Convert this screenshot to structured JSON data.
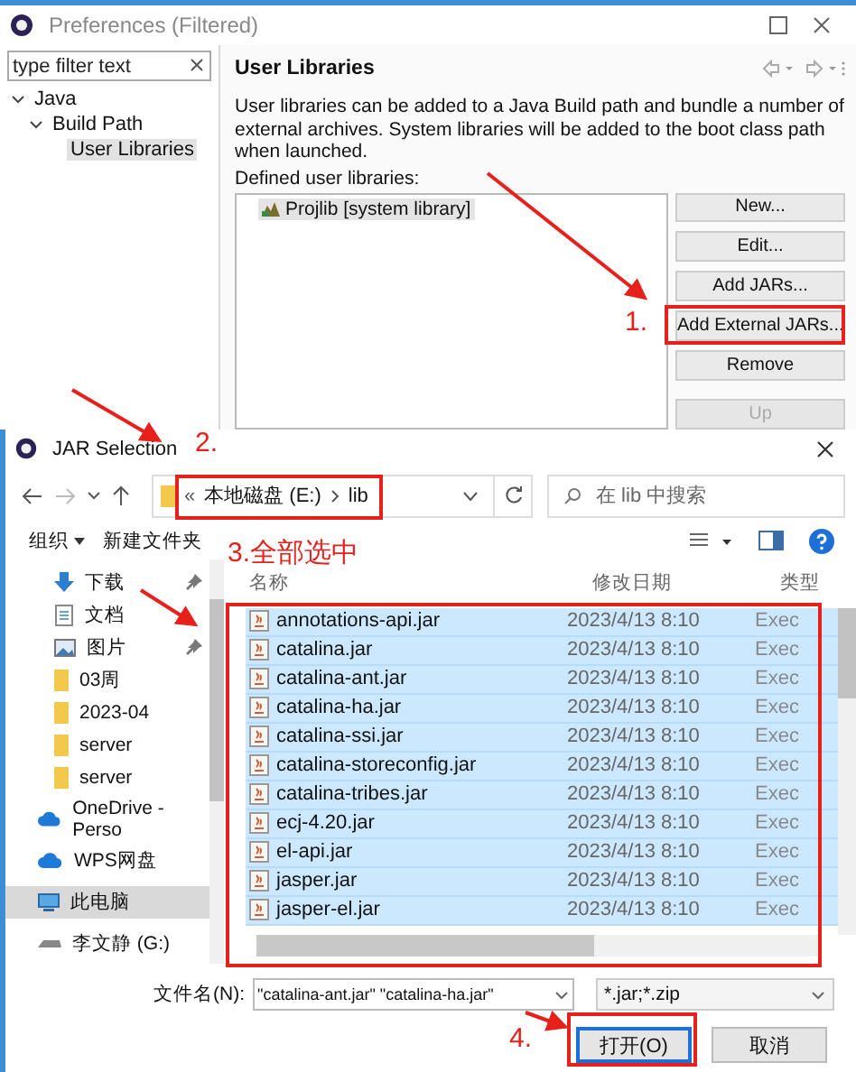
{
  "preferences": {
    "title": "Preferences (Filtered)",
    "filter": {
      "placeholder": "type filter text"
    },
    "tree": [
      {
        "label": "Java",
        "expanded": true,
        "selected": false,
        "children": [
          {
            "label": "Build Path",
            "expanded": true,
            "selected": false,
            "children": [
              {
                "label": "User Libraries",
                "selected": true
              }
            ]
          }
        ]
      }
    ],
    "page_title": "User Libraries",
    "description": "User libraries can be added to a Java Build path and bundle a number of external archives. System libraries will be added to the boot class path when launched.",
    "list_label": "Defined user libraries:",
    "libraries": [
      {
        "label": "Projlib [system library]",
        "selected": true
      }
    ],
    "buttons": [
      {
        "label": "New...",
        "disabled": false
      },
      {
        "label": "Edit...",
        "disabled": false
      },
      {
        "label": "Add JARs...",
        "disabled": false
      },
      {
        "label": "Add External JARs...",
        "disabled": false
      },
      {
        "label": "Remove",
        "disabled": false
      },
      {
        "label": "Up",
        "disabled": true
      }
    ]
  },
  "dialog": {
    "title": "JAR Selection",
    "path": [
      "本地磁盘 (E:)",
      "lib"
    ],
    "path_prefix": "«",
    "search": {
      "placeholder": "在 lib 中搜索"
    },
    "toolbar": {
      "organize": "组织",
      "new_folder": "新建文件夹"
    },
    "nav": [
      {
        "label": "下载",
        "kind": "download",
        "pinned": true,
        "selected": false
      },
      {
        "label": "文档",
        "kind": "document",
        "pinned": false,
        "selected": false
      },
      {
        "label": "图片",
        "kind": "pictures",
        "pinned": true,
        "selected": false
      },
      {
        "label": "03周",
        "kind": "folder",
        "pinned": false,
        "selected": false
      },
      {
        "label": "2023-04",
        "kind": "folder",
        "pinned": false,
        "selected": false
      },
      {
        "label": "server",
        "kind": "folder",
        "pinned": false,
        "selected": false
      },
      {
        "label": "server",
        "kind": "folder",
        "pinned": false,
        "selected": false
      },
      {
        "label": "OneDrive - Perso",
        "kind": "cloud",
        "pinned": false,
        "selected": false
      },
      {
        "label": "WPS网盘",
        "kind": "cloud",
        "pinned": false,
        "selected": false
      },
      {
        "label": "此电脑",
        "kind": "computer",
        "pinned": false,
        "selected": true
      },
      {
        "label": "李文静 (G:)",
        "kind": "drive",
        "pinned": false,
        "selected": false
      }
    ],
    "columns": [
      "名称",
      "修改日期",
      "类型"
    ],
    "files": [
      {
        "name": "annotations-api.jar",
        "date": "2023/4/13 8:10",
        "type": "Exec",
        "selected": true
      },
      {
        "name": "catalina.jar",
        "date": "2023/4/13 8:10",
        "type": "Exec",
        "selected": true
      },
      {
        "name": "catalina-ant.jar",
        "date": "2023/4/13 8:10",
        "type": "Exec",
        "selected": true
      },
      {
        "name": "catalina-ha.jar",
        "date": "2023/4/13 8:10",
        "type": "Exec",
        "selected": true
      },
      {
        "name": "catalina-ssi.jar",
        "date": "2023/4/13 8:10",
        "type": "Exec",
        "selected": true
      },
      {
        "name": "catalina-storeconfig.jar",
        "date": "2023/4/13 8:10",
        "type": "Exec",
        "selected": true
      },
      {
        "name": "catalina-tribes.jar",
        "date": "2023/4/13 8:10",
        "type": "Exec",
        "selected": true
      },
      {
        "name": "ecj-4.20.jar",
        "date": "2023/4/13 8:10",
        "type": "Exec",
        "selected": true
      },
      {
        "name": "el-api.jar",
        "date": "2023/4/13 8:10",
        "type": "Exec",
        "selected": true
      },
      {
        "name": "jasper.jar",
        "date": "2023/4/13 8:10",
        "type": "Exec",
        "selected": true
      },
      {
        "name": "jasper-el.jar",
        "date": "2023/4/13 8:10",
        "type": "Exec",
        "selected": true
      }
    ],
    "filename_label": "文件名(N):",
    "filename": "\"catalina-ant.jar\" \"catalina-ha.jar\"",
    "filetype": "*.jar;*.zip",
    "open_button": "打开(O)",
    "cancel_button": "取消"
  },
  "annotations": [
    {
      "label": "1."
    },
    {
      "label": "2."
    },
    {
      "label": "3.全部选中"
    },
    {
      "label": "4."
    }
  ]
}
